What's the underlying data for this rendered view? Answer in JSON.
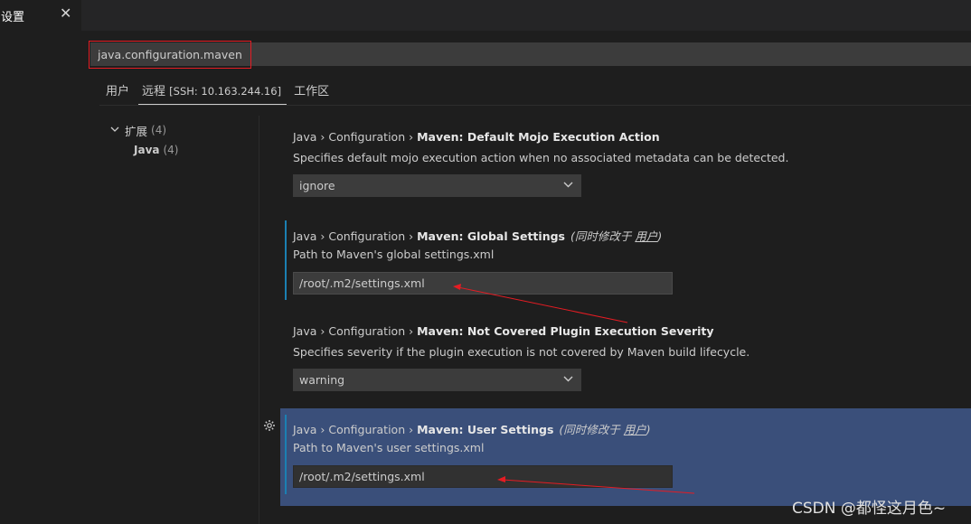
{
  "tab": {
    "title": "设置",
    "close_glyph": "✕"
  },
  "search": {
    "value": "java.configuration.maven"
  },
  "scopes": {
    "user": "用户",
    "remote": "远程",
    "remote_detail": "[SSH: 10.163.244.16]",
    "workspace": "工作区"
  },
  "toc": {
    "group_label": "扩展",
    "group_count": "(4)",
    "child_label": "Java",
    "child_count": "(4)"
  },
  "settings": [
    {
      "category": "Java › Configuration › ",
      "key": "Maven: Default Mojo Execution Action",
      "description": "Specifies default mojo execution action when no associated metadata can be detected.",
      "value": "ignore"
    },
    {
      "category": "Java › Configuration › ",
      "key": "Maven: Global Settings",
      "note_prefix": "(同时修改于 ",
      "note_link": "用户",
      "note_suffix": ")",
      "description": "Path to Maven's global settings.xml",
      "value": "/root/.m2/settings.xml"
    },
    {
      "category": "Java › Configuration › ",
      "key": "Maven: Not Covered Plugin Execution Severity",
      "description": "Specifies severity if the plugin execution is not covered by Maven build lifecycle.",
      "value": "warning"
    },
    {
      "category": "Java › Configuration › ",
      "key": "Maven: User Settings",
      "note_prefix": "(同时修改于 ",
      "note_link": "用户",
      "note_suffix": ")",
      "description": "Path to Maven's user settings.xml",
      "value": "/root/.m2/settings.xml"
    }
  ],
  "icons": {
    "chevron": "chevron-down-icon",
    "gear": "gear-icon",
    "close": "close-icon"
  },
  "colors": {
    "highlight_box": "#e51c23",
    "focused_row": "#3a4f7a",
    "modified_bar": "#1b80b2",
    "annotation_arrow": "#e51c23"
  },
  "watermark": "CSDN @都怪这月色~"
}
